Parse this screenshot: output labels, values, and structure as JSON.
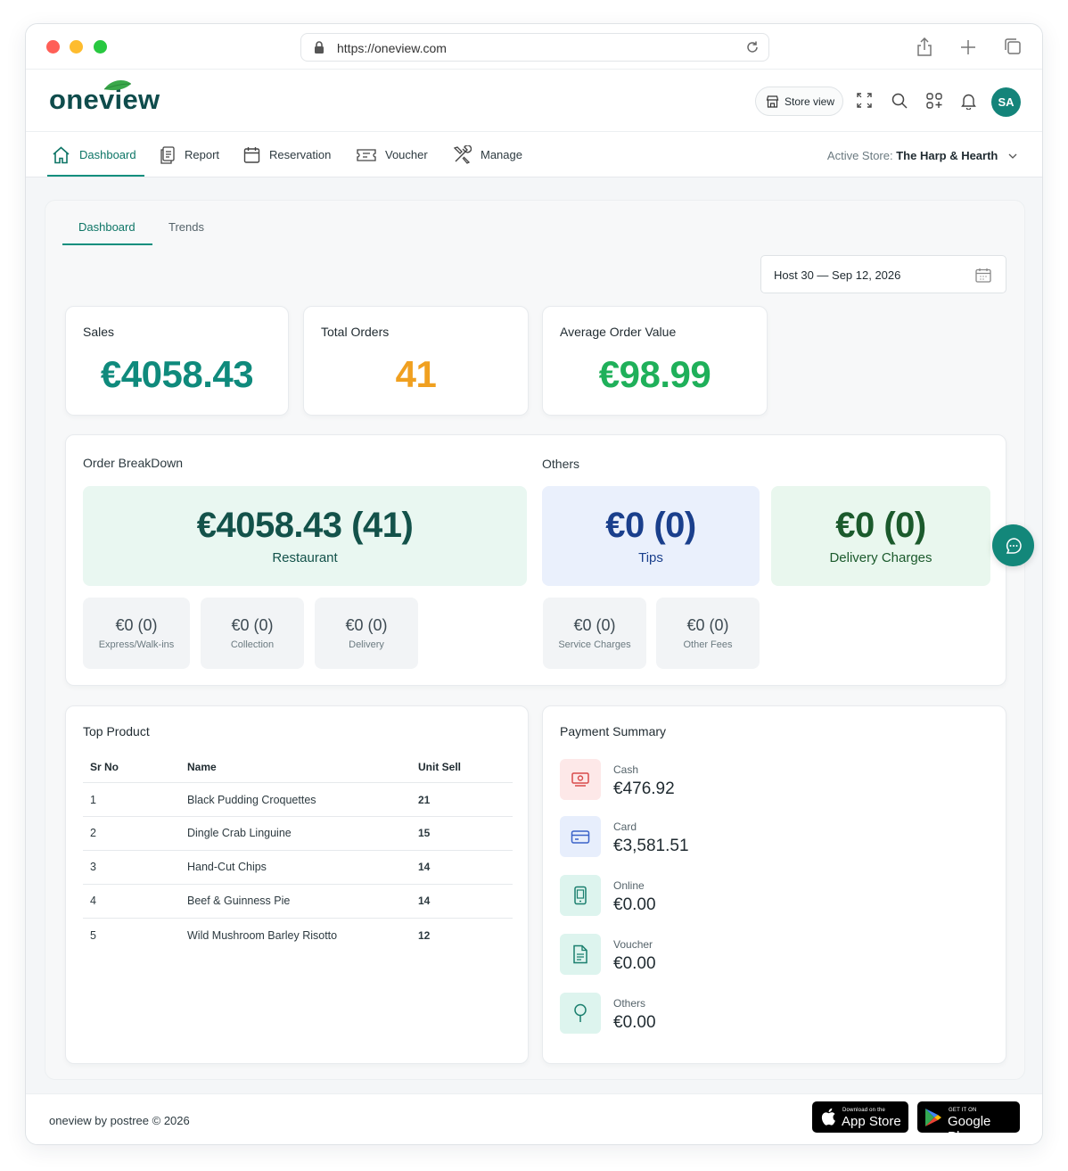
{
  "browser": {
    "url": "https://oneview.com"
  },
  "header": {
    "logo": "oneview",
    "store_view_label": "Store view",
    "avatar_initials": "SA"
  },
  "nav": {
    "items": [
      {
        "label": "Dashboard",
        "icon": "home-icon"
      },
      {
        "label": "Report",
        "icon": "report-icon"
      },
      {
        "label": "Reservation",
        "icon": "calendar-icon"
      },
      {
        "label": "Voucher",
        "icon": "voucher-icon"
      },
      {
        "label": "Manage",
        "icon": "tools-icon"
      }
    ],
    "active_store_label": "Active Store:",
    "active_store_value": "The Harp & Hearth"
  },
  "tabs": [
    {
      "label": "Dashboard"
    },
    {
      "label": "Trends"
    }
  ],
  "date_range": "Host 30 — Sep 12, 2026",
  "kpis": {
    "sales": {
      "title": "Sales",
      "value": "€4058.43",
      "color": "#0f8a7c"
    },
    "orders": {
      "title": "Total Orders",
      "value": "41",
      "color": "#f0a020"
    },
    "aov": {
      "title": "Average Order Value",
      "value": "€98.99",
      "color": "#1fb05a"
    }
  },
  "breakdown": {
    "title": "Order BreakDown",
    "restaurant": {
      "value": "€4058.43 (41)",
      "label": "Restaurant"
    },
    "sub": [
      {
        "value": "€0 (0)",
        "label": "Express/Walk-ins"
      },
      {
        "value": "€0 (0)",
        "label": "Collection"
      },
      {
        "value": "€0 (0)",
        "label": "Delivery"
      }
    ]
  },
  "others": {
    "title": "Others",
    "tips": {
      "value": "€0 (0)",
      "label": "Tips"
    },
    "delivery_charges": {
      "value": "€0 (0)",
      "label": "Delivery Charges"
    },
    "sub": [
      {
        "value": "€0 (0)",
        "label": "Service Charges"
      },
      {
        "value": "€0 (0)",
        "label": "Other Fees"
      }
    ]
  },
  "top_product": {
    "title": "Top Product",
    "headers": {
      "sr": "Sr No",
      "name": "Name",
      "unit": "Unit Sell"
    },
    "rows": [
      {
        "sr": "1",
        "name": "Black Pudding Croquettes",
        "unit": "21"
      },
      {
        "sr": "2",
        "name": "Dingle Crab Linguine",
        "unit": "15"
      },
      {
        "sr": "3",
        "name": "Hand-Cut Chips",
        "unit": "14"
      },
      {
        "sr": "4",
        "name": "Beef & Guinness Pie",
        "unit": "14"
      },
      {
        "sr": "5",
        "name": "Wild Mushroom Barley Risotto",
        "unit": "12"
      }
    ]
  },
  "payment_summary": {
    "title": "Payment Summary",
    "items": [
      {
        "label": "Cash",
        "value": "€476.92",
        "icon": "cash-icon",
        "bg": "#fde8e8",
        "fg": "#d84a4a"
      },
      {
        "label": "Card",
        "value": "€3,581.51",
        "icon": "card-icon",
        "bg": "#e7eefc",
        "fg": "#3a62c8"
      },
      {
        "label": "Online",
        "value": "€0.00",
        "icon": "phone-icon",
        "bg": "#ddf4ee",
        "fg": "#1a7f6e"
      },
      {
        "label": "Voucher",
        "value": "€0.00",
        "icon": "document-icon",
        "bg": "#ddf4ee",
        "fg": "#1a7f6e"
      },
      {
        "label": "Others",
        "value": "€0.00",
        "icon": "pin-icon",
        "bg": "#ddf4ee",
        "fg": "#1a7f6e"
      }
    ]
  },
  "footer": {
    "copyright": "oneview by postree © 2026",
    "app_store_small": "Download on the",
    "app_store_big": "App Store",
    "google_play_small": "GET IT ON",
    "google_play_big": "Google Play"
  }
}
